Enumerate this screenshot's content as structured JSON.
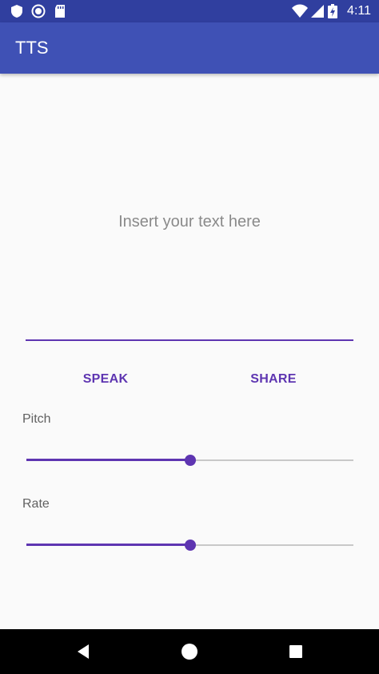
{
  "status_bar": {
    "time": "4:11",
    "icons": [
      "shield-icon",
      "sync-icon",
      "sd-card-icon",
      "wifi-icon",
      "signal-icon",
      "battery-charging-icon"
    ],
    "color": "#303f9f"
  },
  "app_bar": {
    "title": "TTS",
    "color": "#3f51b5"
  },
  "text_input": {
    "placeholder": "Insert your text here",
    "value": ""
  },
  "buttons": {
    "speak": "SPEAK",
    "share": "SHARE"
  },
  "pitch": {
    "label": "Pitch",
    "value": 0.5
  },
  "rate": {
    "label": "Rate",
    "value": 0.5
  },
  "nav_bar": {
    "icons": [
      "back-icon",
      "home-icon",
      "recents-icon"
    ]
  },
  "colors": {
    "accent": "#5e35b1",
    "background": "#fafafa"
  }
}
